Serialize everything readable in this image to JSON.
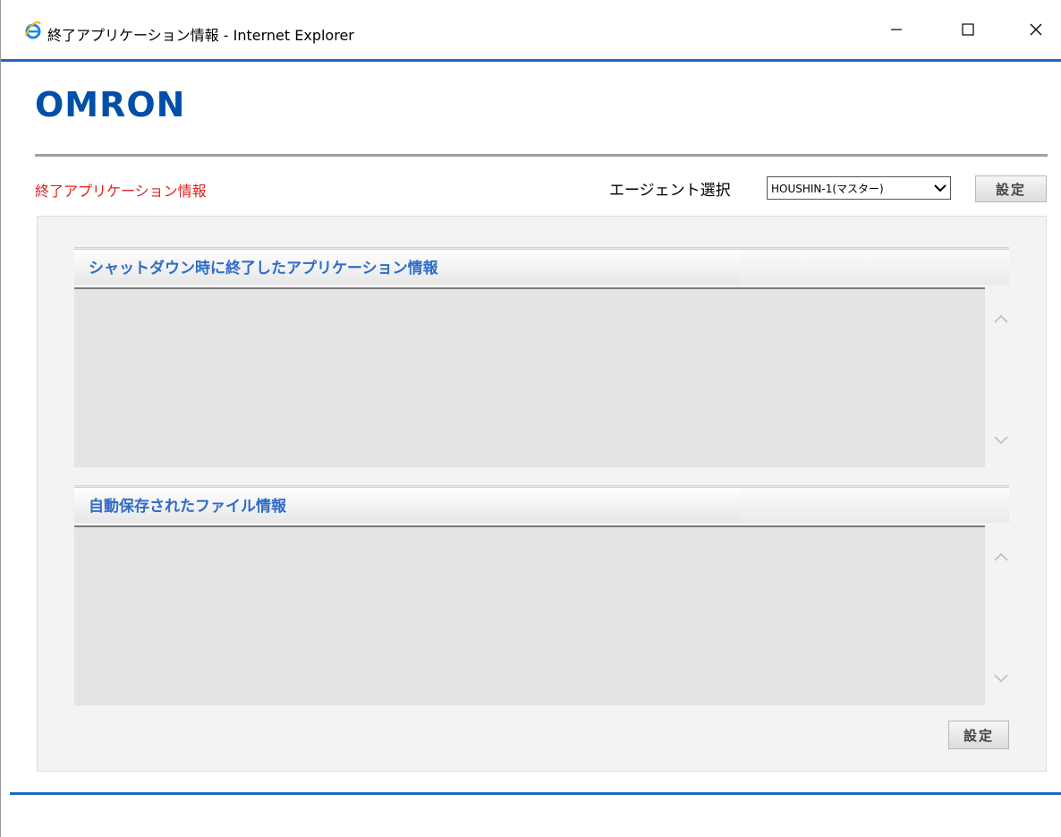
{
  "window": {
    "title": "終了アプリケーション情報 - Internet Explorer",
    "browser_icon": "internet-explorer-icon",
    "controls": [
      "minimize-icon",
      "maximize-icon",
      "close-icon"
    ]
  },
  "header": {
    "logo": "OMRON",
    "logo_color": "#0050a8"
  },
  "toolbar": {
    "page_heading": "終了アプリケーション情報",
    "heading_color": "#e02020",
    "agent_label": "エージェント選択",
    "agent_selected": "HOUSHIN-1(マスター)",
    "set_label": "設定"
  },
  "sections": [
    {
      "title": "シャットダウン時に終了したアプリケーション情報"
    },
    {
      "title": "自動保存されたファイル情報"
    }
  ],
  "footer": {
    "set_label": "設定"
  },
  "colors": {
    "accent_blue": "#2265c4",
    "section_title": "#2f6bc9"
  }
}
